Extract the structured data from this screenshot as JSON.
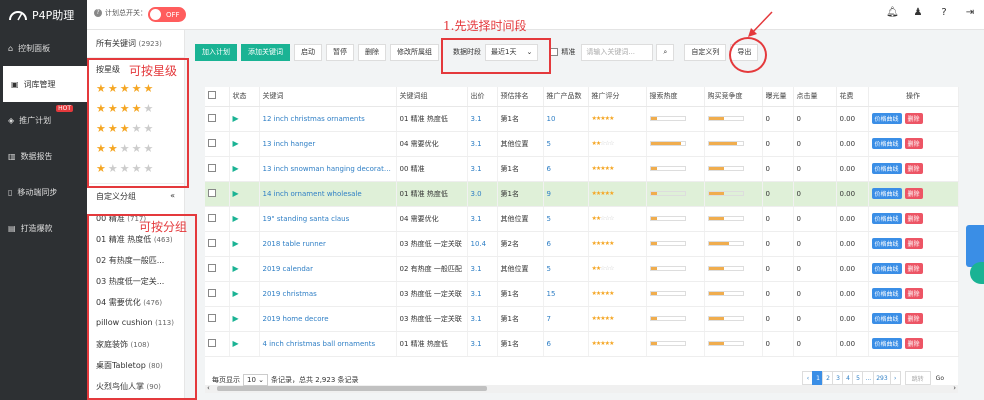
{
  "app": {
    "title": "P4P助理"
  },
  "topbar": {
    "autoplan_label": "计划总开关：",
    "toggle_label": "OFF"
  },
  "sidebar": {
    "items": [
      {
        "label": "控制面板",
        "icon": "home-icon"
      },
      {
        "label": "词库管理",
        "icon": "monitor-icon",
        "active": true
      },
      {
        "label": "推广计划",
        "icon": "tag-icon",
        "badge": "HOT"
      },
      {
        "label": "数据报告",
        "icon": "chart-icon"
      },
      {
        "label": "移动端同步",
        "icon": "mobile-icon"
      },
      {
        "label": "打造爆款",
        "icon": "card-icon"
      }
    ]
  },
  "leftpanel": {
    "all_label": "所有关键词",
    "all_count": "(2923)",
    "star_label": "按星级",
    "star_levels": [
      5,
      4,
      3,
      2,
      1
    ],
    "custom_group_label": "自定义分组",
    "collapse": "«",
    "groups": [
      {
        "name": "00 精准",
        "count": "(717)"
      },
      {
        "name": "01 精准 热度低",
        "count": "(463)"
      },
      {
        "name": "02 有热度一般匹...",
        "count": ""
      },
      {
        "name": "03 热度低一定关...",
        "count": ""
      },
      {
        "name": "04 需要优化",
        "count": "(476)"
      },
      {
        "name": "pillow cushion",
        "count": "(113)"
      },
      {
        "name": "家庭装饰",
        "count": "(108)"
      },
      {
        "name": "桌面Tabletop",
        "count": "(80)"
      },
      {
        "name": "火烈鸟仙人掌",
        "count": "(90)"
      }
    ]
  },
  "toolbar": {
    "add_plan": "加入计划",
    "add_keyword": "添加关键词",
    "start": "启动",
    "pause": "暂停",
    "delete": "删除",
    "edit_group": "修改所属组",
    "date_label": "数据时段",
    "date_value": "最近1天",
    "exact_label": "精准",
    "search_placeholder": "请输入关键词...",
    "custom_columns": "自定义列",
    "export": "导出"
  },
  "annotations": {
    "step1": "1.先选择时间段",
    "by_star": "可按星级",
    "by_group": "可按分组"
  },
  "table": {
    "headers": [
      "",
      "状态",
      "关键词",
      "关键词组",
      "出价",
      "预估排名",
      "推广产品数",
      "推广评分",
      "搜索热度",
      "购买竞争度",
      "曝光量",
      "点击量",
      "花费",
      "操作"
    ],
    "rows": [
      {
        "kw": "12 inch christmas ornaments",
        "group": "01 精准 热度低",
        "bid": "3.1",
        "rank": "第1名",
        "products": "10",
        "score": 5,
        "heat": 0.18,
        "comp": 0.45,
        "exp": "0",
        "clk": "0",
        "cost": "0.00"
      },
      {
        "kw": "13 inch hanger",
        "group": "04 需要优化",
        "bid": "3.1",
        "rank": "其他位置",
        "products": "5",
        "score": 2,
        "heat": 0.9,
        "comp": 0.85,
        "exp": "0",
        "clk": "0",
        "cost": "0.00"
      },
      {
        "kw": "13 inch snowman hanging decorations",
        "group": "00 精准",
        "bid": "3.1",
        "rank": "第1名",
        "products": "6",
        "score": 5,
        "heat": 0.2,
        "comp": 0.45,
        "exp": "0",
        "clk": "0",
        "cost": "0.00"
      },
      {
        "kw": "14 inch ornament wholesale",
        "group": "01 精准 热度低",
        "bid": "3.0",
        "rank": "第1名",
        "products": "9",
        "score": 5,
        "heat": 0.18,
        "comp": 0.45,
        "exp": "0",
        "clk": "0",
        "cost": "0.00",
        "highlight": true
      },
      {
        "kw": "19\" standing santa claus",
        "group": "04 需要优化",
        "bid": "3.1",
        "rank": "其他位置",
        "products": "5",
        "score": 2,
        "heat": 0.2,
        "comp": 0.45,
        "exp": "0",
        "clk": "0",
        "cost": "0.00"
      },
      {
        "kw": "2018 table runner",
        "group": "03 热度低 一定关联",
        "bid": "10.4",
        "rank": "第2名",
        "products": "6",
        "score": 5,
        "heat": 0.18,
        "comp": 0.6,
        "exp": "0",
        "clk": "0",
        "cost": "0.00"
      },
      {
        "kw": "2019 calendar",
        "group": "02 有热度 一般匹配",
        "bid": "3.1",
        "rank": "其他位置",
        "products": "5",
        "score": 2,
        "heat": 0.2,
        "comp": 0.45,
        "exp": "0",
        "clk": "0",
        "cost": "0.00"
      },
      {
        "kw": "2019 christmas",
        "group": "03 热度低 一定关联",
        "bid": "3.1",
        "rank": "第1名",
        "products": "15",
        "score": 5,
        "heat": 0.18,
        "comp": 0.45,
        "exp": "0",
        "clk": "0",
        "cost": "0.00"
      },
      {
        "kw": "2019 home decore",
        "group": "03 热度低 一定关联",
        "bid": "3.1",
        "rank": "第1名",
        "products": "7",
        "score": 5,
        "heat": 0.2,
        "comp": 0.45,
        "exp": "0",
        "clk": "0",
        "cost": "0.00"
      },
      {
        "kw": "4 inch christmas ball ornaments",
        "group": "01 精准 热度低",
        "bid": "3.1",
        "rank": "第1名",
        "products": "6",
        "score": 5,
        "heat": 0.18,
        "comp": 0.45,
        "exp": "0",
        "clk": "0",
        "cost": "0.00"
      }
    ],
    "op_curve": "价格曲线",
    "op_delete": "删除"
  },
  "footer": {
    "per_page_label": "每页显示",
    "per_page": "10",
    "records": "条记录，总共 2,923 条记录"
  },
  "pager": {
    "prev": "‹",
    "pages": [
      "1",
      "2",
      "3",
      "4",
      "5",
      "...",
      "293"
    ],
    "next": "›",
    "jump_placeholder": "跳转",
    "go": "Go"
  }
}
